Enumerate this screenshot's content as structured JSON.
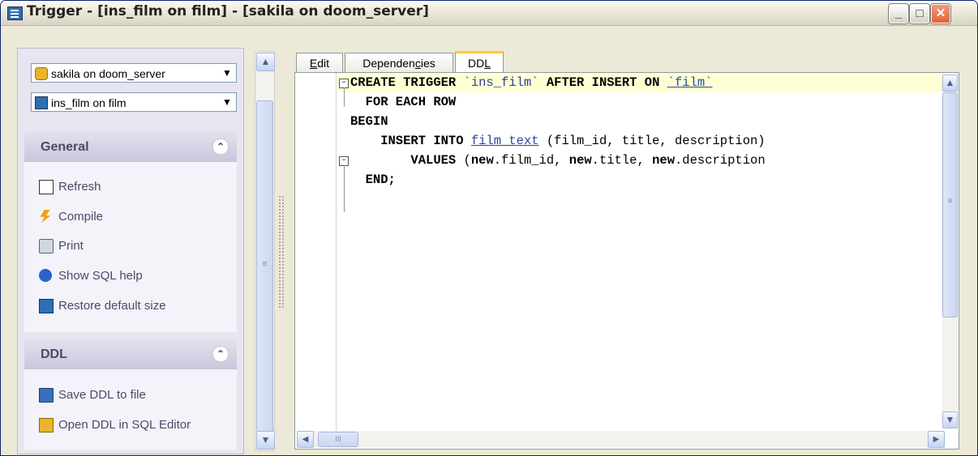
{
  "window": {
    "title": "Trigger - [ins_film on film] - [sakila on doom_server]",
    "min_glyph": "_",
    "max_glyph": "□",
    "close_glyph": "✕"
  },
  "sidebar": {
    "database_combo": {
      "value": "sakila on doom_server",
      "arrow": "▼"
    },
    "object_combo": {
      "value": "ins_film on film",
      "arrow": "▼"
    },
    "groups": [
      {
        "title": "General",
        "collapse_glyph": "⌃",
        "items": [
          {
            "label": "Refresh",
            "icon": "refresh-icon"
          },
          {
            "label": "Compile",
            "icon": "compile-icon"
          },
          {
            "label": "Print",
            "icon": "print-icon"
          },
          {
            "label": "Show SQL help",
            "icon": "help-icon"
          },
          {
            "label": "Restore default size",
            "icon": "restore-icon"
          }
        ]
      },
      {
        "title": "DDL",
        "collapse_glyph": "⌃",
        "items": [
          {
            "label": "Save DDL to file",
            "icon": "save-icon"
          },
          {
            "label": "Open DDL in SQL Editor",
            "icon": "open-editor-icon"
          }
        ]
      }
    ]
  },
  "tabs": [
    {
      "label_pre": "",
      "hotkey": "E",
      "label_post": "dit",
      "active": false
    },
    {
      "label_pre": "Dependen",
      "hotkey": "c",
      "label_post": "ies",
      "active": false
    },
    {
      "label_pre": "DD",
      "hotkey": "L",
      "label_post": "",
      "active": true
    }
  ],
  "editor": {
    "lines": [
      {
        "parts": [
          {
            "t": "CREATE TRIGGER ",
            "c": "kw"
          },
          {
            "t": "`ins_film`",
            "c": "str"
          },
          {
            "t": " AFTER INSERT ON ",
            "c": "kw"
          },
          {
            "t": "`film`",
            "c": "ul"
          }
        ]
      },
      {
        "parts": [
          {
            "t": "  FOR EACH ROW",
            "c": "kw"
          }
        ]
      },
      {
        "parts": [
          {
            "t": "BEGIN",
            "c": "kw"
          }
        ]
      },
      {
        "parts": [
          {
            "t": "    INSERT INTO ",
            "c": "kw"
          },
          {
            "t": "film_text",
            "c": "ul"
          },
          {
            "t": " (film_id, title, description)",
            "c": ""
          }
        ]
      },
      {
        "parts": [
          {
            "t": "        VALUES ",
            "c": "kw"
          },
          {
            "t": "(",
            "c": ""
          },
          {
            "t": "new",
            "c": "kw"
          },
          {
            "t": ".film_id, ",
            "c": ""
          },
          {
            "t": "new",
            "c": "kw"
          },
          {
            "t": ".title, ",
            "c": ""
          },
          {
            "t": "new",
            "c": "kw"
          },
          {
            "t": ".description",
            "c": ""
          }
        ]
      },
      {
        "parts": [
          {
            "t": "  END;",
            "c": "kw"
          }
        ]
      }
    ],
    "vscroll": {
      "up": "▲",
      "down": "▼",
      "grip": "≡"
    },
    "hscroll": {
      "left": "◀",
      "right": "▶",
      "grip": "III"
    }
  },
  "left_scroll": {
    "up": "▲",
    "down": "▼",
    "grip": "≡"
  }
}
